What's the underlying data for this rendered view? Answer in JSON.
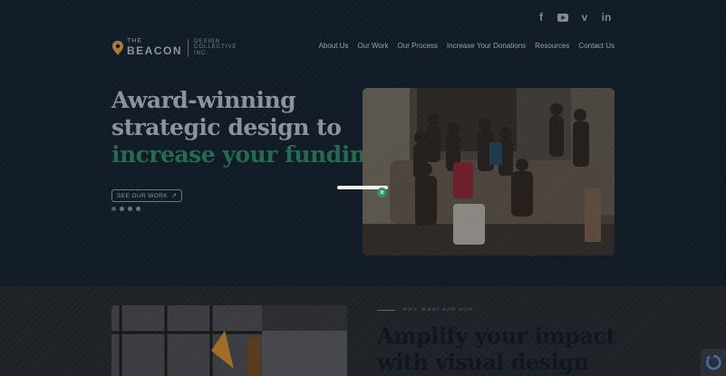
{
  "social": {
    "icons": [
      "facebook-icon",
      "youtube-icon",
      "vimeo-icon",
      "linkedin-icon"
    ],
    "glyphs": [
      "f",
      "▶",
      "v",
      "in"
    ]
  },
  "logo": {
    "the": "THE",
    "beacon": "BEACON",
    "tagline": "DESIGN COLLECTIVE INC."
  },
  "nav": {
    "items": [
      "About Us",
      "Our Work",
      "Our Process",
      "Increase Your Donations",
      "Resources",
      "Contact Us"
    ]
  },
  "hero": {
    "headline_line1": "Award-winning",
    "headline_line2": "strategic design to",
    "headline_line3": "increase your funding.",
    "cta_label": "SEE OUR WORK",
    "cta_arrow": "↗",
    "slides_total": 4,
    "slide_active": 1
  },
  "loader": {
    "badge": "×"
  },
  "section2": {
    "eyebrow": "WHY, WHAT AND HOW",
    "title_line1": "Amplify your impact",
    "title_line2": "with visual design"
  },
  "colors": {
    "hero_bg": "#101b26",
    "accent_green": "#246a4f",
    "lower_bg": "#1e2227"
  }
}
